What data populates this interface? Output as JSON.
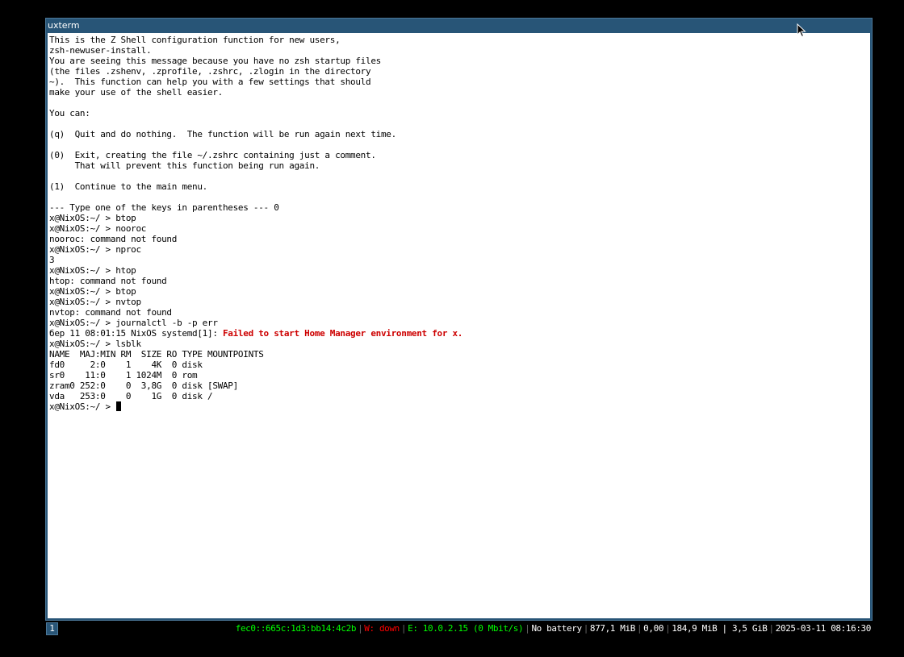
{
  "window": {
    "title": "uxterm"
  },
  "terminal": {
    "lines": [
      {
        "text": "This is the Z Shell configuration function for new users,"
      },
      {
        "text": "zsh-newuser-install."
      },
      {
        "text": "You are seeing this message because you have no zsh startup files"
      },
      {
        "text": "(the files .zshenv, .zprofile, .zshrc, .zlogin in the directory"
      },
      {
        "text": "~).  This function can help you with a few settings that should"
      },
      {
        "text": "make your use of the shell easier."
      },
      {
        "text": ""
      },
      {
        "text": "You can:"
      },
      {
        "text": ""
      },
      {
        "text": "(q)  Quit and do nothing.  The function will be run again next time."
      },
      {
        "text": ""
      },
      {
        "text": "(0)  Exit, creating the file ~/.zshrc containing just a comment."
      },
      {
        "text": "     That will prevent this function being run again."
      },
      {
        "text": ""
      },
      {
        "text": "(1)  Continue to the main menu."
      },
      {
        "text": ""
      },
      {
        "text": "--- Type one of the keys in parentheses --- 0"
      },
      {
        "text": "x@NixOS:~/ > btop"
      },
      {
        "text": "x@NixOS:~/ > nooroc"
      },
      {
        "text": "nooroc: command not found"
      },
      {
        "text": "x@NixOS:~/ > nproc"
      },
      {
        "text": "3"
      },
      {
        "text": "x@NixOS:~/ > htop"
      },
      {
        "text": "htop: command not found"
      },
      {
        "text": "x@NixOS:~/ > btop"
      },
      {
        "text": "x@NixOS:~/ > nvtop"
      },
      {
        "text": "nvtop: command not found"
      },
      {
        "text": "x@NixOS:~/ > journalctl -b -p err"
      },
      {
        "text": "бер 11 08:01:15 NixOS systemd[1]: ",
        "error_text": "Failed to start Home Manager environment for x."
      },
      {
        "text": "x@NixOS:~/ > lsblk"
      },
      {
        "text": "NAME  MAJ:MIN RM  SIZE RO TYPE MOUNTPOINTS"
      },
      {
        "text": "fd0     2:0    1    4K  0 disk"
      },
      {
        "text": "sr0    11:0    1 1024M  0 rom"
      },
      {
        "text": "zram0 252:0    0  3,8G  0 disk [SWAP]"
      },
      {
        "text": "vda   253:0    0    1G  0 disk /"
      },
      {
        "text": "x@NixOS:~/ > ",
        "cursor": true
      }
    ],
    "error_color": "#cd0000"
  },
  "statusbar": {
    "workspace": "1",
    "blocks": [
      {
        "text": "fec0::665c:1d3:bb14:4c2b",
        "color": "#00ff00"
      },
      {
        "text": "W: down",
        "color": "#ff0000"
      },
      {
        "text": "E: 10.0.2.15 (0 Mbit/s)",
        "color": "#00ff00"
      },
      {
        "text": "No battery",
        "color": "#ffffff"
      },
      {
        "text": "877,1 MiB",
        "color": "#ffffff"
      },
      {
        "text": "0,00",
        "color": "#ffffff"
      },
      {
        "text": "184,9 MiB | 3,5 GiB",
        "color": "#ffffff"
      },
      {
        "text": "2025-03-11 08:16:30",
        "color": "#ffffff"
      }
    ],
    "separator": "|"
  },
  "colors": {
    "focused_title_bg": "#285577",
    "focused_border": "#4c7899",
    "terminal_bg": "#ffffff",
    "terminal_fg": "#000000"
  },
  "icons": {
    "mouse_pointer": "mouse-pointer-icon"
  }
}
